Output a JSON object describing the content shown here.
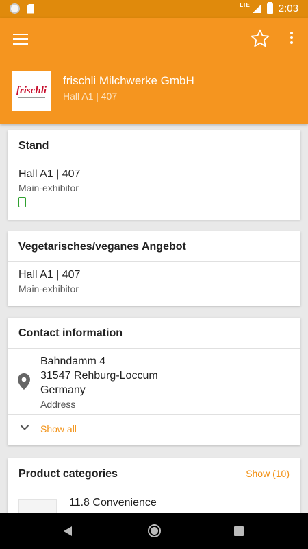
{
  "status_bar": {
    "time": "2:03",
    "network": "LTE"
  },
  "header": {
    "logo_text": "frischli",
    "company_name": "frischli Milchwerke GmbH",
    "location": "Hall A1 | 407"
  },
  "stand": {
    "title": "Stand",
    "location": "Hall A1 | 407",
    "role": "Main-exhibitor"
  },
  "vegan": {
    "title": "Vegetarisches/veganes Angebot",
    "location": "Hall A1 | 407",
    "role": "Main-exhibitor"
  },
  "contact": {
    "title": "Contact information",
    "address_lines": [
      "Bahndamm 4",
      "31547 Rehburg-Loccum",
      "Germany"
    ],
    "address_label": "Address",
    "show_all": "Show all"
  },
  "categories": {
    "title": "Product categories",
    "show_label": "Show (10)",
    "items": [
      "11.8 Convenience"
    ]
  },
  "colors": {
    "primary": "#f5951f",
    "status_bar": "#e08a0c",
    "accent_text": "#f29012",
    "stand_marker": "#2fa02f"
  }
}
